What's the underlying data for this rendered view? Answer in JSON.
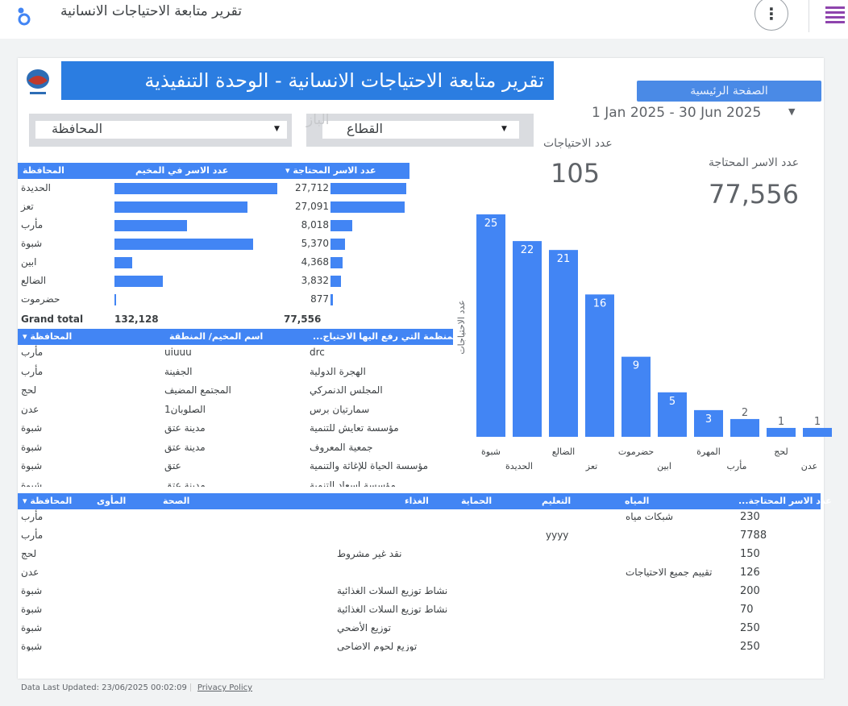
{
  "app": {
    "title": "تقرير متابعة الاحتياجات الانسانية"
  },
  "report": {
    "banner": "تقرير متابعة الاحتياجات الانسانية - الوحدة التنفيذية",
    "home_button": "الصفحة الرئيسية",
    "date_range": "1 Jan 2025 - 30 Jun 2025",
    "ghost_sector": "الباز"
  },
  "filters": {
    "governorate": "المحافظة",
    "sector": "القطاع"
  },
  "kpis": {
    "needs_label": "عدد الاحتياجات",
    "needs_value": "105",
    "families_label": "عدد الاسر المحتاجة",
    "families_value": "77,556"
  },
  "colors": {
    "accent": "#4285f4",
    "banner": "#2b7de1"
  },
  "table1": {
    "headers": [
      "المحافظة",
      "عدد الاسر في المخيم",
      "عدد الاسر المحتاجة ▾"
    ],
    "rows": [
      {
        "gov": "الحديدة",
        "camp": 27000,
        "needy": "27,712",
        "needy_n": 27712
      },
      {
        "gov": "تعز",
        "camp": 22000,
        "needy": "27,091",
        "needy_n": 27091
      },
      {
        "gov": "مأرب",
        "camp": 12000,
        "needy": "8,018",
        "needy_n": 8018
      },
      {
        "gov": "شبوة",
        "camp": 23000,
        "needy": "5,370",
        "needy_n": 5370
      },
      {
        "gov": "ابين",
        "camp": 3000,
        "needy": "4,368",
        "needy_n": 4368
      },
      {
        "gov": "الضالع",
        "camp": 8000,
        "needy": "3,832",
        "needy_n": 3832
      },
      {
        "gov": "حضرموت",
        "camp": 300,
        "needy": "877",
        "needy_n": 877
      }
    ],
    "total_label": "Grand total",
    "total_camp": "132,128",
    "total_needy": "77,556"
  },
  "table2": {
    "headers": [
      "المحافظة ▾",
      "اسم المخيم/ المنطقة",
      "المنظمة التي رفع اليها الاحتياج..."
    ],
    "rows": [
      [
        "مأرب",
        "uiuuu",
        "drc"
      ],
      [
        "مأرب",
        "الجفينة",
        "الهجرة الدولية"
      ],
      [
        "لحج",
        "المجتمع المضيف",
        "المجلس الدنمركي"
      ],
      [
        "عدن",
        "الصلوبان1",
        "سمارتيان برس"
      ],
      [
        "شبوة",
        "مدينة عتق",
        "مؤسسة تعايش للتنمية"
      ],
      [
        "شبوة",
        "مدينة عتق",
        "جمعية المعروف"
      ],
      [
        "شبوة",
        "عتق",
        "مؤسسة الحياة للإغاثة والتنمية"
      ],
      [
        "شبوة",
        "مدينة عتق",
        "مؤسسة إسعاد التنمية"
      ]
    ]
  },
  "chart_data": {
    "type": "bar",
    "ylabel": "عدد الاحتياجات",
    "categories": [
      "شبوة",
      "الحديدة",
      "الضالع",
      "تعز",
      "حضرموت",
      "ابين",
      "المهرة",
      "مأرب",
      "لحج",
      "عدن"
    ],
    "values": [
      25,
      22,
      21,
      16,
      9,
      5,
      3,
      2,
      1,
      1
    ]
  },
  "table3": {
    "headers": [
      "المحافظة ▾",
      "المأوى",
      "الصحة",
      "الغذاء",
      "الحماية",
      "التعليم",
      "المياه",
      "عدد الاسر المحتاجة..."
    ],
    "rows": [
      {
        "gov": "مأرب",
        "shelter": "",
        "health": "",
        "food": "",
        "protection": "",
        "education": "",
        "water": "شبكات مياه",
        "families": "230"
      },
      {
        "gov": "مأرب",
        "shelter": "",
        "health": "",
        "food": "",
        "protection": "",
        "education": "yyyy",
        "water": "",
        "families": "7788"
      },
      {
        "gov": "لحج",
        "shelter": "",
        "health": "",
        "food": "نقد غير مشروط",
        "protection": "",
        "education": "",
        "water": "",
        "families": "150"
      },
      {
        "gov": "عدن",
        "shelter": "",
        "health": "",
        "food": "",
        "protection": "",
        "education": "",
        "water": "تقييم جميع الاحتياجات",
        "families": "126"
      },
      {
        "gov": "شبوة",
        "shelter": "",
        "health": "",
        "food": "نشاط توزيع السلات الغذائية",
        "protection": "",
        "education": "",
        "water": "",
        "families": "200"
      },
      {
        "gov": "شبوة",
        "shelter": "",
        "health": "",
        "food": "نشاط توزيع السلات الغذائية",
        "protection": "",
        "education": "",
        "water": "",
        "families": "70"
      },
      {
        "gov": "شبوة",
        "shelter": "",
        "health": "",
        "food": "توزيع الأضحي",
        "protection": "",
        "education": "",
        "water": "",
        "families": "250"
      },
      {
        "gov": "شبوة",
        "shelter": "",
        "health": "",
        "food": "توزيع لحوم الاضاحي",
        "protection": "",
        "education": "",
        "water": "",
        "families": "250"
      }
    ]
  },
  "footer": {
    "updated": "Data Last Updated: 23/06/2025 00:02:09",
    "privacy": "Privacy Policy"
  }
}
